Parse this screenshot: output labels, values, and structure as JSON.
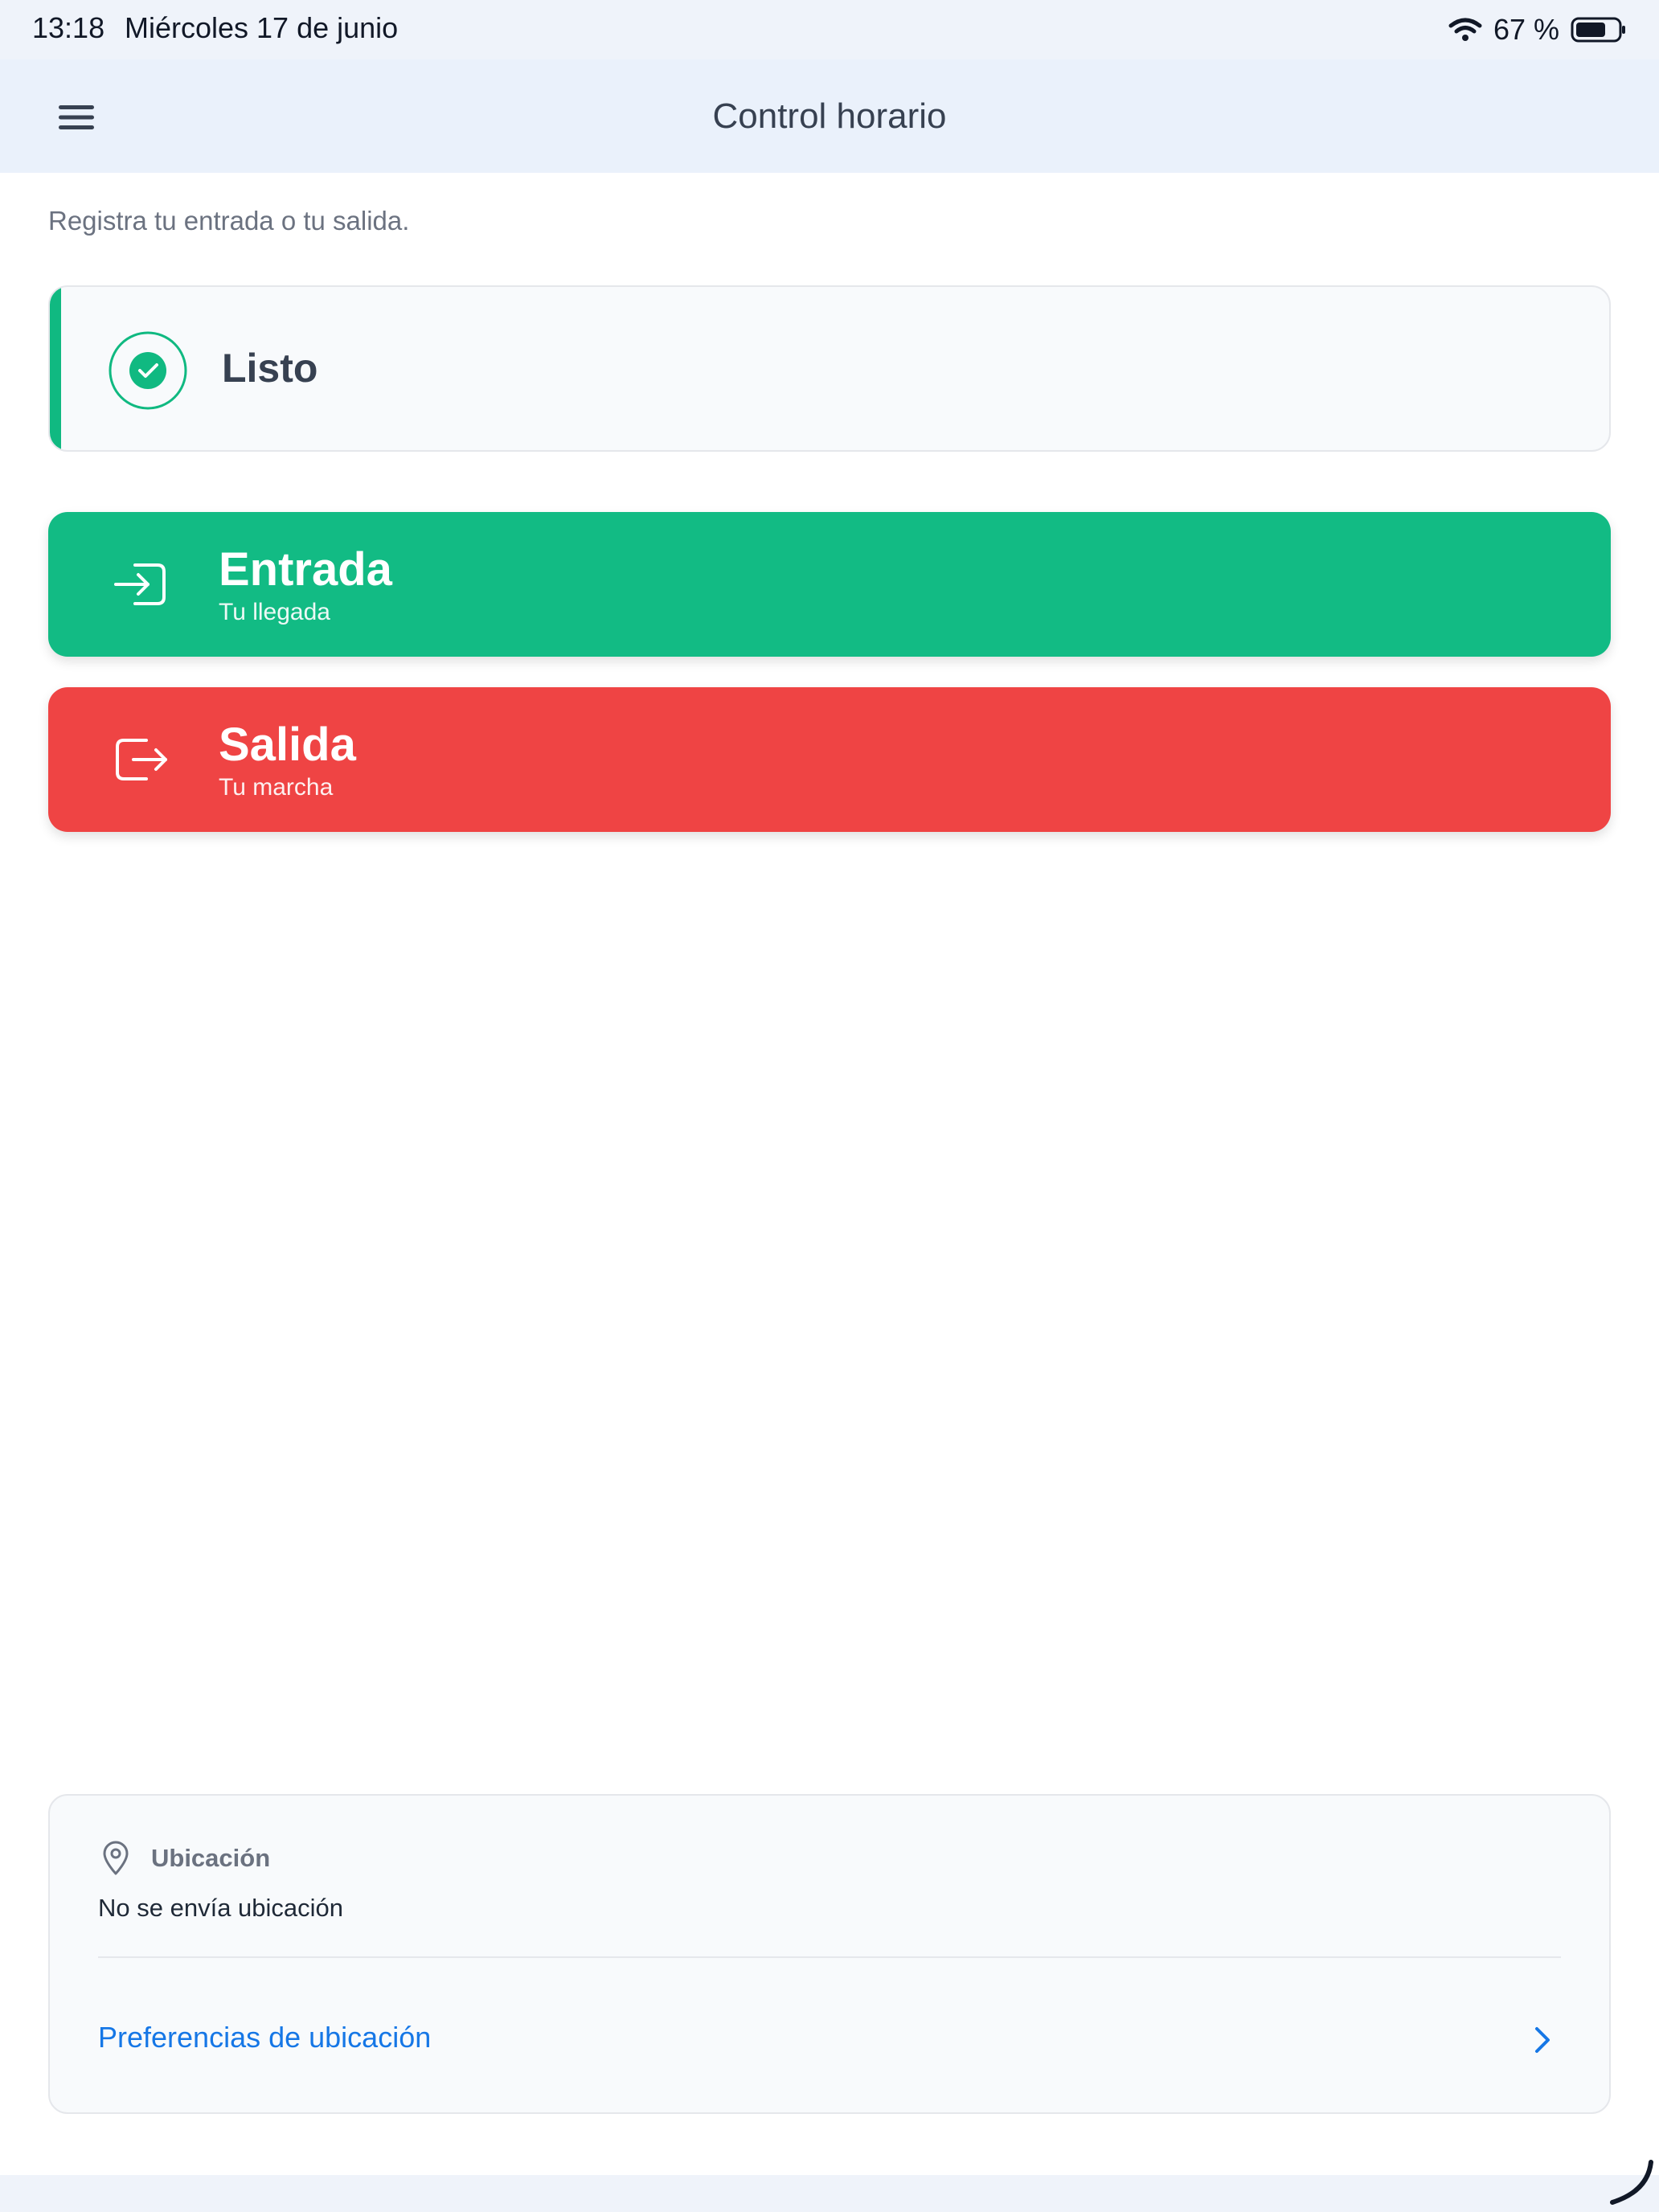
{
  "status_bar": {
    "time": "13:18",
    "date": "Miércoles 17 de junio",
    "battery_percent": "67 %"
  },
  "header": {
    "title": "Control horario",
    "menu_icon": "hamburger-menu-icon"
  },
  "subtitle": "Registra tu entrada o tu salida.",
  "status_card": {
    "label": "Listo",
    "icon": "check-circle-icon",
    "accent_color": "#10b981"
  },
  "actions": {
    "entrada": {
      "title": "Entrada",
      "subtitle": "Tu llegada",
      "icon": "sign-in-icon",
      "color": "#12bb84"
    },
    "salida": {
      "title": "Salida",
      "subtitle": "Tu marcha",
      "icon": "sign-out-icon",
      "color": "#ef4444"
    }
  },
  "location": {
    "heading": "Ubicación",
    "icon": "map-pin-icon",
    "value": "No se envía ubicación",
    "link_label": "Preferencias de ubicación",
    "link_color": "#1677e6"
  }
}
